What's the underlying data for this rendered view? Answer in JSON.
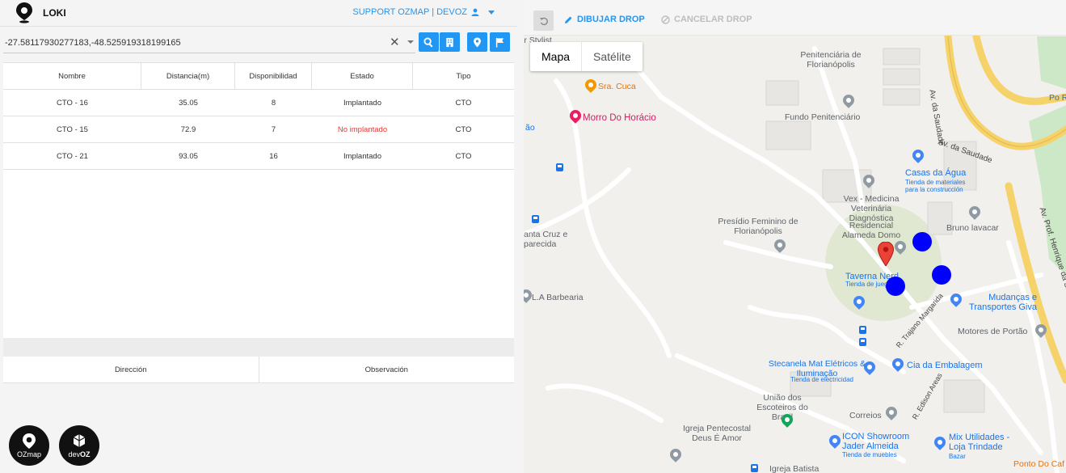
{
  "header": {
    "title": "LOKI",
    "user_menu": "SUPPORT OZMAP | DEVOZ"
  },
  "search": {
    "coordinates": "-27.58117930277183,-48.525919318199165",
    "clear_symbol": "✕"
  },
  "results": {
    "columns": [
      "Nombre",
      "Distancia(m)",
      "Disponibilidad",
      "Estado",
      "Tipo"
    ],
    "rows": [
      {
        "nombre": "CTO - 16",
        "distancia": "35.05",
        "disponibilidad": "8",
        "estado": "Implantado",
        "tipo": "CTO"
      },
      {
        "nombre": "CTO - 15",
        "distancia": "72.9",
        "disponibilidad": "7",
        "estado": "No implantado",
        "tipo": "CTO"
      },
      {
        "nombre": "CTO - 21",
        "distancia": "93.05",
        "disponibilidad": "16",
        "estado": "Implantado",
        "tipo": "CTO"
      }
    ]
  },
  "details": {
    "columns": [
      "Dirección",
      "Observación"
    ]
  },
  "brands": {
    "ozmap": "OZmap",
    "devoz_prefix": "dev",
    "devoz_suffix": "OZ"
  },
  "map": {
    "toolbar": {
      "draw_label": "DIBUJAR DROP",
      "cancel_label": "CANCELAR DROP"
    },
    "map_type": {
      "map": "Mapa",
      "satellite": "Satélite"
    },
    "labels": {
      "stylist": "ir Stylist",
      "penitenciaria": "Penitenciária de Florianópolis",
      "sra_cuca": "Sra. Cuca",
      "morro": "Morro Do Horácio",
      "fundo": "Fundo Penitenciário",
      "av_saudade_v": "Av. da Saudade",
      "av_saudade_d": "Av. da Saudade",
      "casas": "Casas da Água",
      "casas_sub": "Tienda de materiales para la construcción",
      "vex": "Vex - Medicina Veterinária Diagnóstica",
      "presidio": "Presídio Feminino de Florianópolis",
      "residencial": "Residencial Alameda Domo",
      "bruno": "Bruno lavacar",
      "taverna": "Taverna Nerd",
      "taverna_sub": "Tienda de juegos",
      "santa_cruz": "anta Cruz e parecida",
      "barbearia": "L.A Barbearia",
      "trajano": "R. Trajano Margarida",
      "mudancas": "Mudanças e Transportes Giva",
      "motores": "Motores de Portão",
      "stecanela": "Stecanela Mat Elétricos & Iluminação",
      "stecanela_sub": "Tienda de electricidad",
      "cia": "Cia da Embalagem",
      "uniao": "União dos Escoteiros do Brasil",
      "edison": "R. Edison Areas",
      "correios": "Correios",
      "igreja": "Igreja Pentecostal Deus É Amor",
      "icon": "ICON Showroom Jader Almeida",
      "icon_sub": "Tienda de muebles",
      "mix": "Mix Utilidades - Loja Trindade",
      "mix_sub": "Bazar",
      "av_prof": "Av. Prof. Henrique da Silva F",
      "ponto": "Ponto Do Caf",
      "igreja_batista": "Igreja Batista",
      "ao": "ão",
      "po": "Po Ro"
    }
  },
  "colors": {
    "accent": "#2196f3",
    "cto_marker": "#0000ff",
    "not_deployed": "#e53935"
  }
}
